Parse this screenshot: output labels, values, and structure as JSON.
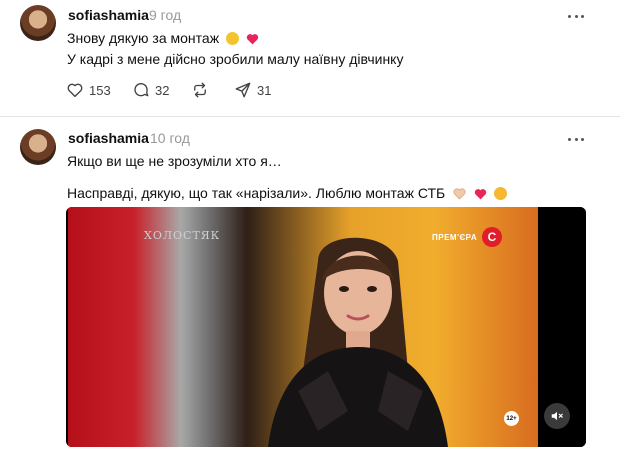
{
  "posts": [
    {
      "username": "sofiashamia",
      "time": "9 год",
      "line1": "Знову дякую за монтаж",
      "line2": "У кадрі з мене дійсно зробили малу наївну дівчинку",
      "likes": "153",
      "comments": "32",
      "shares": "31"
    },
    {
      "username": "sofiashamia",
      "time": "10 год",
      "line1": "Якщо ви ще не зрозуміли хто я…",
      "line2": "Насправді, дякую, що так «нарізали». Люблю монтаж СТБ",
      "video": {
        "show_logo": "ХОЛОСТЯК",
        "premiere_label": "ПРЕМ'ЄРА",
        "channel_logo": "C",
        "age_rating": "12+"
      }
    }
  ],
  "colors": {
    "heart": "#e8245a",
    "muted": "#999999",
    "channel": "#e21d2a"
  },
  "icons": [
    "heart-icon",
    "comment-icon",
    "repost-icon",
    "share-icon",
    "more-icon",
    "mute-icon"
  ]
}
